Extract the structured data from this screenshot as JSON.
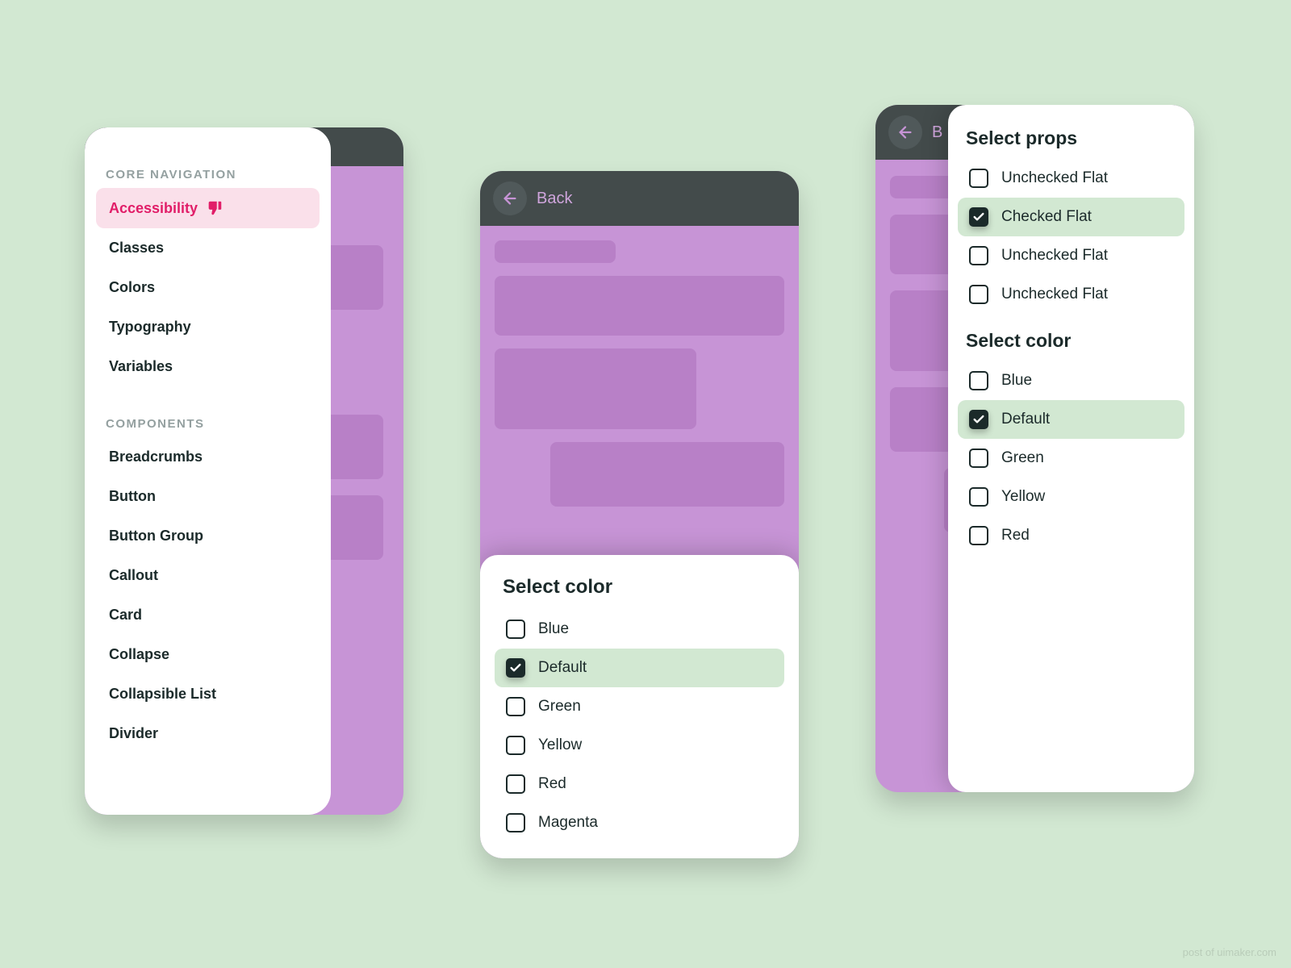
{
  "panel1": {
    "section1_title": "CORE NAVIGATION",
    "section2_title": "COMPONENTS",
    "core_items": [
      {
        "label": "Accessibility",
        "active": true
      },
      {
        "label": "Classes"
      },
      {
        "label": "Colors"
      },
      {
        "label": "Typography"
      },
      {
        "label": "Variables"
      }
    ],
    "component_items": [
      {
        "label": "Breadcrumbs"
      },
      {
        "label": "Button"
      },
      {
        "label": "Button Group"
      },
      {
        "label": "Callout"
      },
      {
        "label": "Card"
      },
      {
        "label": "Collapse"
      },
      {
        "label": "Collapsible List"
      },
      {
        "label": "Divider"
      }
    ]
  },
  "panel2": {
    "header_title": "Back",
    "sheet_title": "Select color",
    "options": [
      {
        "label": "Blue",
        "selected": false
      },
      {
        "label": "Default",
        "selected": true
      },
      {
        "label": "Green",
        "selected": false
      },
      {
        "label": "Yellow",
        "selected": false
      },
      {
        "label": "Red",
        "selected": false
      },
      {
        "label": "Magenta",
        "selected": false
      }
    ]
  },
  "panel3": {
    "header_title_truncated": "B",
    "section1_title": "Select props",
    "props_options": [
      {
        "label": "Unchecked Flat",
        "selected": false
      },
      {
        "label": "Checked Flat",
        "selected": true
      },
      {
        "label": "Unchecked Flat",
        "selected": false
      },
      {
        "label": "Unchecked Flat",
        "selected": false
      }
    ],
    "section2_title": "Select color",
    "color_options": [
      {
        "label": "Blue",
        "selected": false
      },
      {
        "label": "Default",
        "selected": true
      },
      {
        "label": "Green",
        "selected": false
      },
      {
        "label": "Yellow",
        "selected": false
      },
      {
        "label": "Red",
        "selected": false
      }
    ]
  },
  "watermark": "post of uimaker.com"
}
